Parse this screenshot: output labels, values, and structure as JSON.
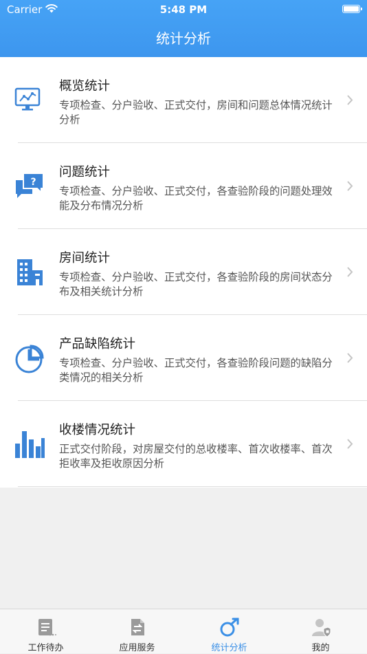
{
  "status": {
    "carrier": "Carrier",
    "time": "5:48 PM"
  },
  "header": {
    "title": "统计分析"
  },
  "items": [
    {
      "title": "概览统计",
      "desc": "专项检查、分户验收、正式交付，房间和问题总体情况统计分析",
      "icon": "monitor-chart-icon"
    },
    {
      "title": "问题统计",
      "desc": "专项检查、分户验收、正式交付，各查验阶段的问题处理效能及分布情况分析",
      "icon": "question-chat-icon"
    },
    {
      "title": "房间统计",
      "desc": "专项检查、分户验收、正式交付，各查验阶段的房间状态分布及相关统计分析",
      "icon": "building-icon"
    },
    {
      "title": "产品缺陷统计",
      "desc": "专项检查、分户验收、正式交付，各查验阶段问题的缺陷分类情况的相关分析",
      "icon": "pie-chart-icon"
    },
    {
      "title": "收楼情况统计",
      "desc": "正式交付阶段，对房屋交付的总收楼率、首次收楼率、首次拒收率及拒收原因分析",
      "icon": "bar-chart-icon"
    }
  ],
  "tabs": [
    {
      "label": "工作待办",
      "icon": "todo-list-icon"
    },
    {
      "label": "应用服务",
      "icon": "app-service-icon"
    },
    {
      "label": "统计分析",
      "icon": "statistics-icon",
      "active": true
    },
    {
      "label": "我的",
      "icon": "profile-icon"
    }
  ],
  "colors": {
    "accent": "#3d96ee",
    "icon": "#3a83d6"
  }
}
